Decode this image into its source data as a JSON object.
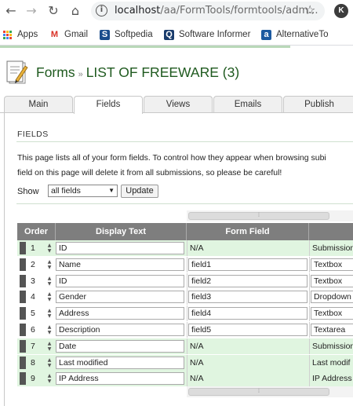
{
  "browser": {
    "url_host": "localhost",
    "url_path": "/aa/FormTools/formtools/adm...",
    "profile_initial": "K",
    "bookmarks": [
      "Apps",
      "Gmail",
      "Softpedia",
      "Software Informer",
      "AlternativeTo"
    ]
  },
  "header": {
    "section": "Forms",
    "separator": "»",
    "form_name": "LIST OF FREEWARE (3)"
  },
  "tabs": [
    {
      "label": "Main",
      "active": false
    },
    {
      "label": "Fields",
      "active": true
    },
    {
      "label": "Views",
      "active": false
    },
    {
      "label": "Emails",
      "active": false
    },
    {
      "label": "Publish",
      "active": false
    }
  ],
  "fields_section": {
    "title": "FIELDS",
    "desc_line1": "This page lists all of your form fields. To control how they appear when browsing subi",
    "desc_line2": "field on this page will delete it from all submissions, so please be careful!",
    "show_label": "Show",
    "show_value": "all fields",
    "update_label": "Update"
  },
  "grid": {
    "columns": [
      "Order",
      "Display Text",
      "Form Field",
      ""
    ],
    "rows": [
      {
        "order": "1",
        "display": "ID",
        "field": "N/A",
        "type": "Submission",
        "system": true
      },
      {
        "order": "2",
        "display": "Name",
        "field": "field1",
        "type": "Textbox",
        "system": false
      },
      {
        "order": "3",
        "display": "ID",
        "field": "field2",
        "type": "Textbox",
        "system": false
      },
      {
        "order": "4",
        "display": "Gender",
        "field": "field3",
        "type": "Dropdown",
        "system": false
      },
      {
        "order": "5",
        "display": "Address",
        "field": "field4",
        "type": "Textbox",
        "system": false
      },
      {
        "order": "6",
        "display": "Description",
        "field": "field5",
        "type": "Textarea",
        "system": false
      },
      {
        "order": "7",
        "display": "Date",
        "field": "N/A",
        "type": "Submission",
        "system": true
      },
      {
        "order": "8",
        "display": "Last modified",
        "field": "N/A",
        "type": "Last modif",
        "system": true
      },
      {
        "order": "9",
        "display": "IP Address",
        "field": "N/A",
        "type": "IP Address",
        "system": true
      }
    ]
  },
  "colors": {
    "system_row": "#e0f5e0",
    "normal_row": "#ffffff",
    "title_green": "#1f5a1f"
  }
}
